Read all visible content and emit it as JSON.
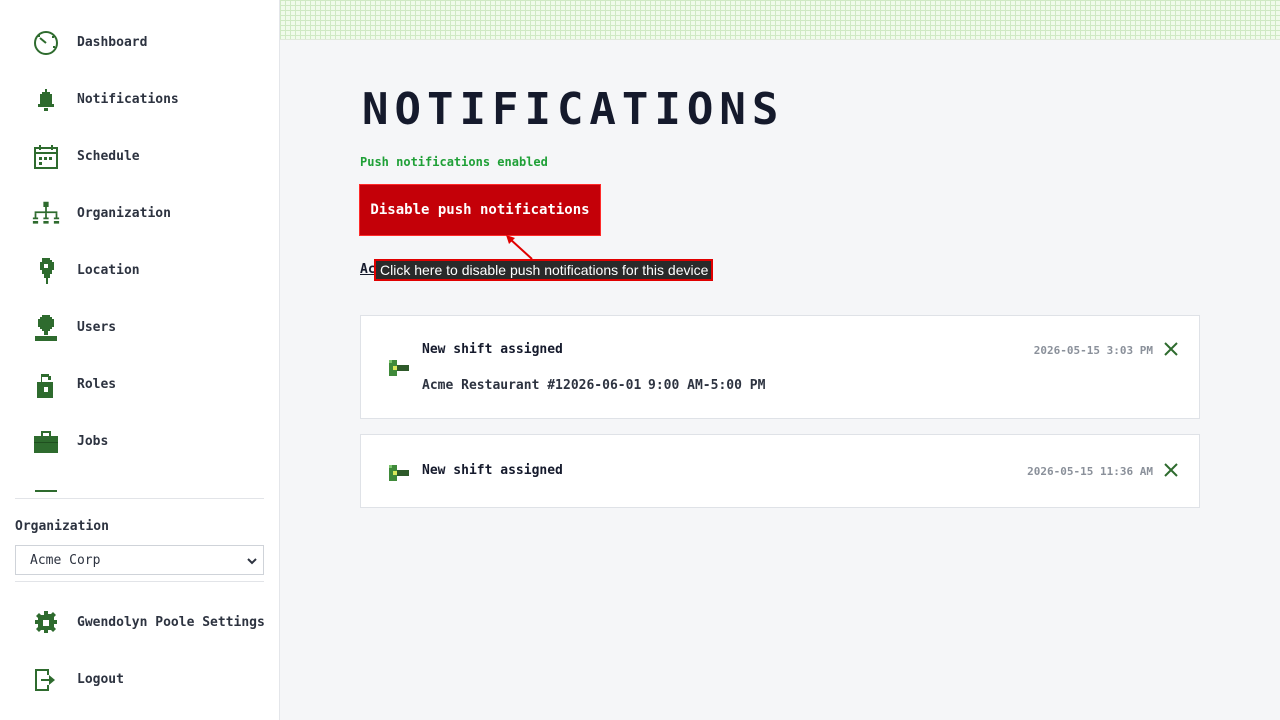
{
  "sidebar": {
    "items": [
      {
        "label": "Dashboard",
        "icon": "dashboard-icon"
      },
      {
        "label": "Notifications",
        "icon": "bell-icon"
      },
      {
        "label": "Schedule",
        "icon": "calendar-icon"
      },
      {
        "label": "Organization",
        "icon": "org-chart-icon"
      },
      {
        "label": "Location",
        "icon": "location-pin-icon"
      },
      {
        "label": "Users",
        "icon": "user-icon"
      },
      {
        "label": "Roles",
        "icon": "lock-icon"
      },
      {
        "label": "Jobs",
        "icon": "briefcase-icon"
      }
    ],
    "org_label": "Organization",
    "org_selected": "Acme Corp",
    "settings_label": "Gwendolyn Poole Settings",
    "logout_label": "Logout"
  },
  "main": {
    "title": "NOTIFICATIONS",
    "push_status": "Push notifications enabled",
    "disable_button": "Disable push notifications",
    "action_link_visible": "Ac",
    "tooltip": "Click here to disable push notifications for this device"
  },
  "notifications": [
    {
      "title": "New shift assigned",
      "location": "Acme Restaurant #1",
      "date": "2026-06-01",
      "time_range": "9:00 AM-5:00 PM",
      "timestamp": "2026-05-15 3:03 PM"
    },
    {
      "title": "New shift assigned",
      "timestamp": "2026-05-15 11:36 AM"
    }
  ],
  "colors": {
    "accent_green": "#2e6b2e",
    "danger": "#c40008",
    "success": "#1fa037"
  }
}
